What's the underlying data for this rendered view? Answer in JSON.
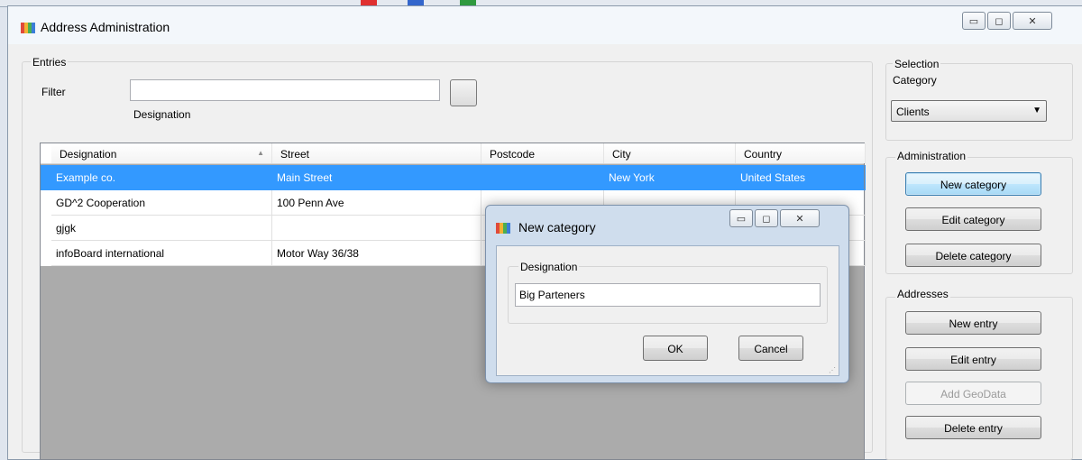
{
  "window": {
    "title": "Address Administration",
    "icon": "app-icon",
    "controls": {
      "minimize": "▭",
      "maximize": "◻",
      "close": "✕"
    }
  },
  "entries": {
    "group_label": "Entries",
    "filter_label": "Filter",
    "filter_value": "",
    "filter_caption": "Designation",
    "columns": [
      "Designation",
      "Street",
      "Postcode",
      "City",
      "Country"
    ],
    "sort_indicator": "▲",
    "rows": [
      {
        "designation": "Example co.",
        "street": "Main Street",
        "postcode": "",
        "city": "New York",
        "country": "United States"
      },
      {
        "designation": "GD^2 Cooperation",
        "street": "100 Penn Ave",
        "postcode": "",
        "city": "",
        "country": ""
      },
      {
        "designation": "gjgk",
        "street": "",
        "postcode": "",
        "city": "",
        "country": ""
      },
      {
        "designation": "infoBoard international",
        "street": "Motor Way 36/38",
        "postcode": "",
        "city": "",
        "country": ""
      }
    ],
    "selected_row": 0
  },
  "selection": {
    "group_label": "Selection",
    "category_label": "Category",
    "category_value": "Clients",
    "dropdown_arrow": "▼"
  },
  "administration": {
    "group_label": "Administration",
    "buttons": [
      "New category",
      "Edit category",
      "Delete category"
    ]
  },
  "addresses": {
    "group_label": "Addresses",
    "buttons": [
      "New entry",
      "Edit entry",
      "Add GeoData",
      "Delete entry"
    ],
    "disabled": [
      "Add GeoData"
    ]
  },
  "dialog": {
    "title": "New category",
    "group_label": "Designation",
    "input_value": "Big Parteners",
    "ok_label": "OK",
    "cancel_label": "Cancel",
    "controls": {
      "minimize": "▭",
      "maximize": "◻",
      "close": "✕"
    }
  },
  "colors": {
    "selection": "#3399ff",
    "window_bg": "#f0f0f0",
    "grid_empty": "#ababab",
    "dialog_frame": "#cfdded"
  }
}
